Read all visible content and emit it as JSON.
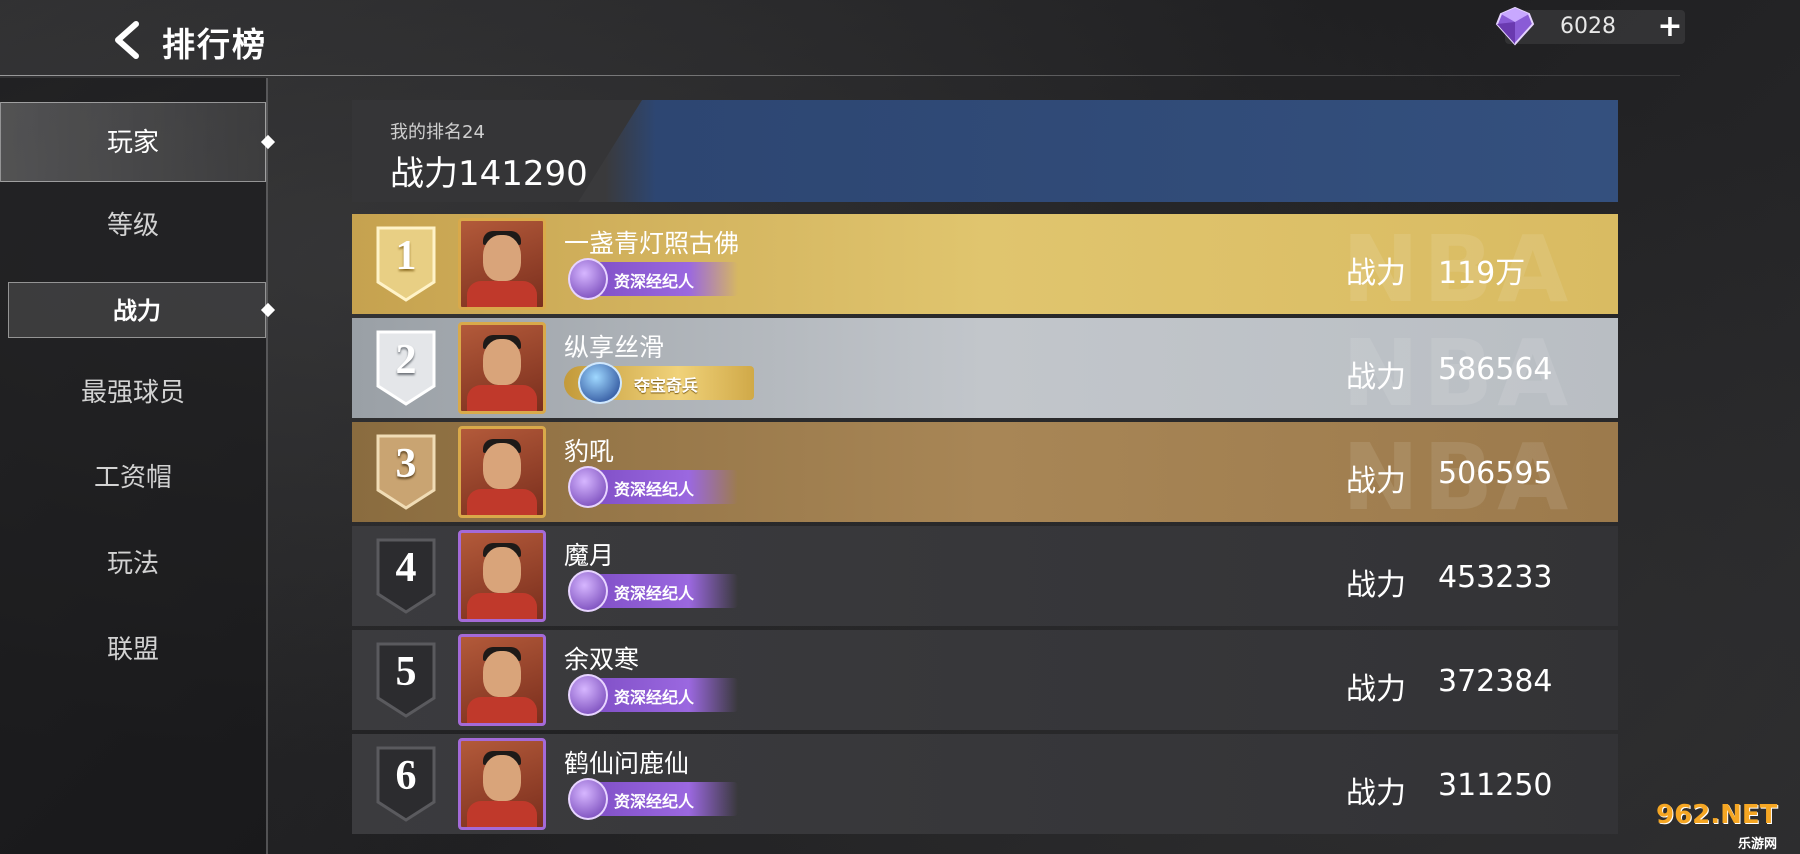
{
  "header": {
    "title": "排行榜",
    "currency_value": "6028",
    "plus_label": "+"
  },
  "sidebar": {
    "items": [
      {
        "label": "玩家"
      },
      {
        "label": "等级"
      },
      {
        "label": "战力"
      },
      {
        "label": "最强球员"
      },
      {
        "label": "工资帽"
      },
      {
        "label": "玩法"
      },
      {
        "label": "联盟"
      }
    ]
  },
  "my_rank": {
    "rank_label": "我的排名24",
    "power_label": "战力141290"
  },
  "rows": [
    {
      "rank": "1",
      "name": "一盏青灯照古佛",
      "badge": "资深经纪人",
      "power_label": "战力",
      "power": "119万",
      "tier": "gold"
    },
    {
      "rank": "2",
      "name": "纵享丝滑",
      "badge": "夺宝奇兵",
      "power_label": "战力",
      "power": "586564",
      "tier": "silver"
    },
    {
      "rank": "3",
      "name": "豹吼",
      "badge": "资深经纪人",
      "power_label": "战力",
      "power": "506595",
      "tier": "bronze"
    },
    {
      "rank": "4",
      "name": "魔月",
      "badge": "资深经纪人",
      "power_label": "战力",
      "power": "453233",
      "tier": "normal"
    },
    {
      "rank": "5",
      "name": "余双寒",
      "badge": "资深经纪人",
      "power_label": "战力",
      "power": "372384",
      "tier": "normal"
    },
    {
      "rank": "6",
      "name": "鹤仙问鹿仙",
      "badge": "资深经纪人",
      "power_label": "战力",
      "power": "311250",
      "tier": "normal"
    }
  ],
  "row_watermark": "NBA",
  "site_watermark": {
    "top": "962.NET",
    "bottom": "乐游网"
  },
  "colors": {
    "gold": "#d9bb62",
    "silver": "#c2c6cb",
    "bronze": "#a88656",
    "badge_purple": "#9b68e0",
    "my_rank_blue": "#34507e"
  }
}
